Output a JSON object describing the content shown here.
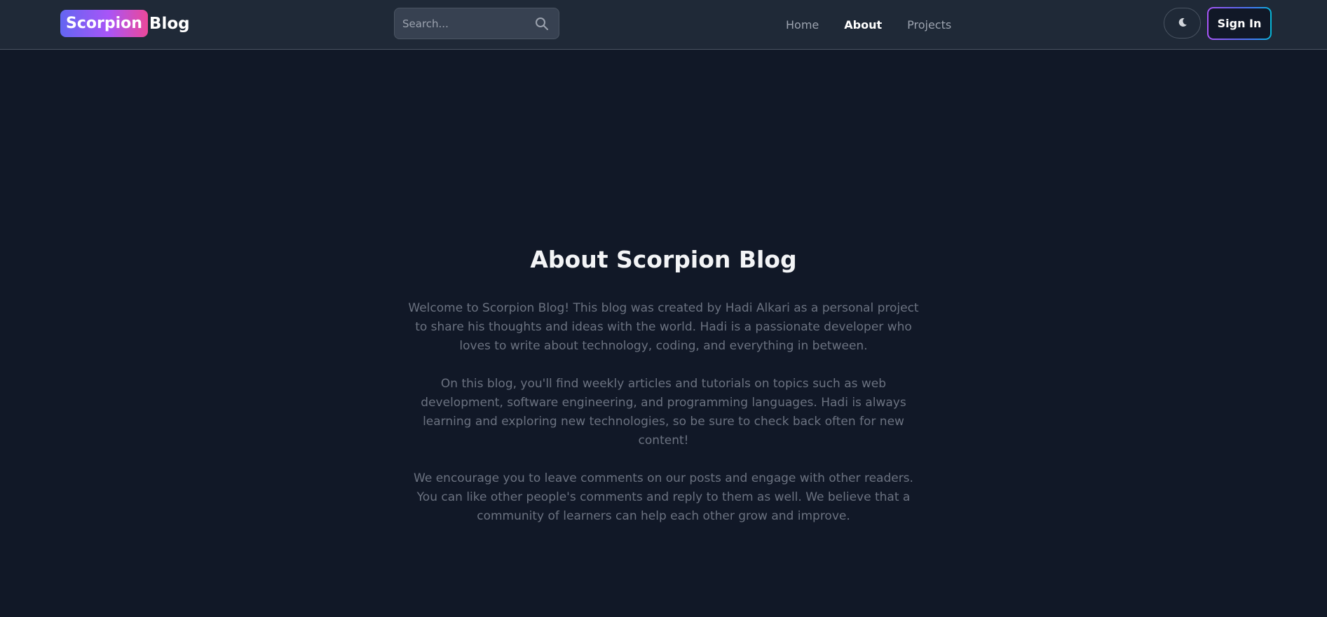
{
  "header": {
    "logo_badge": "Scorpion",
    "logo_word": "Blog",
    "search": {
      "placeholder": "Search..."
    },
    "nav": [
      {
        "label": "Home"
      },
      {
        "label": "About"
      },
      {
        "label": "Projects"
      }
    ],
    "active_nav": "About",
    "signin_label": "Sign In",
    "theme_icon": "moon-icon"
  },
  "main": {
    "title": "About Scorpion Blog",
    "paragraphs": [
      "Welcome to Scorpion Blog! This blog was created by Hadi Alkari as a personal project to share his thoughts and ideas with the world. Hadi is a passionate developer who loves to write about technology, coding, and everything in between.",
      "On this blog, you'll find weekly articles and tutorials on topics such as web development, software engineering, and programming languages. Hadi is always learning and exploring new technologies, so be sure to check back often for new content!",
      "We encourage you to leave comments on our posts and engage with other readers. You can like other people's comments and reply to them as well. We believe that a community of learners can help each other grow and improve."
    ]
  },
  "colors": {
    "page_background": "#111827",
    "navbar_background": "#1f2937",
    "logo_gradient": [
      "#6366f1",
      "#a855f7",
      "#ec4899"
    ],
    "signin_border_gradient": [
      "#a855f7",
      "#6366f1",
      "#06b6d4"
    ],
    "body_text": "#6b7280"
  }
}
